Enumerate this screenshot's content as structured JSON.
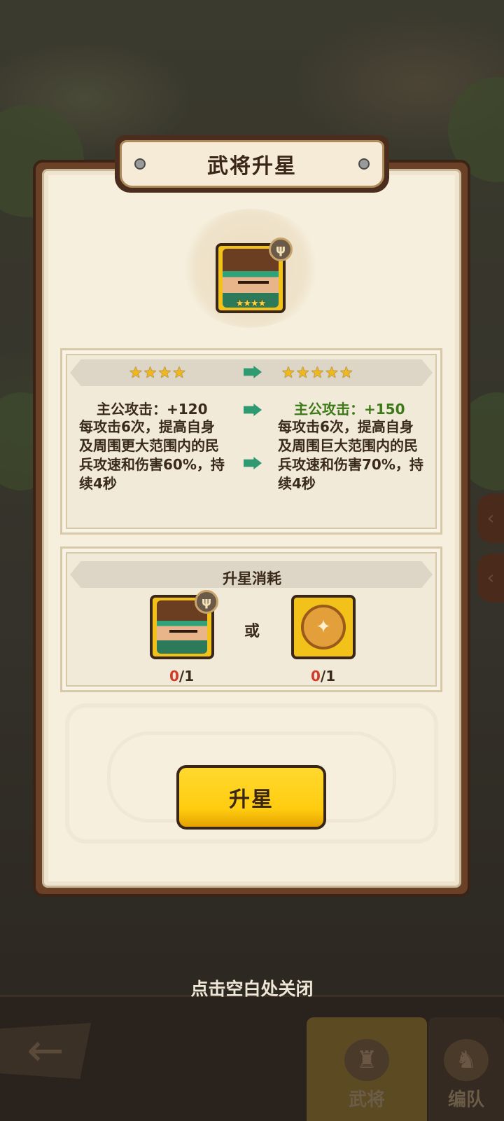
{
  "dialog": {
    "title": "武将升星"
  },
  "hero": {
    "trait_icon": "trident-badge-icon",
    "stars_now": "★★★★",
    "stars_next": "★★★★★"
  },
  "stats": {
    "current": {
      "attack_line": "主公攻击：+120",
      "skill_desc": "每攻击6次，提高自身及周围更大范围内的民兵攻速和伤害60%，持续4秒"
    },
    "next": {
      "attack_line": "主公攻击：+150",
      "skill_desc": "每攻击6次，提高自身及周围巨大范围内的民兵攻速和伤害70%，持续4秒"
    },
    "arrow_icon": "green-arrow-icon"
  },
  "cost": {
    "title": "升星消耗",
    "or_label": "或",
    "hero_have": "0",
    "hero_need": "/1",
    "item_have": "0",
    "item_need": "/1",
    "item_icon": "universal-hero-token-icon"
  },
  "action": {
    "upgrade_label": "升星"
  },
  "close_hint": "点击空白处关闭",
  "bottom_nav": {
    "back_icon": "back-arrow-icon",
    "tabs": [
      {
        "label": "武将",
        "active": true
      },
      {
        "label": "编队",
        "active": false
      }
    ]
  },
  "colors": {
    "accent_yellow": "#ffcc10",
    "upgrade_green": "#3c7a18",
    "shortfall_red": "#d43a2a",
    "panel_brown": "#6a4127"
  }
}
